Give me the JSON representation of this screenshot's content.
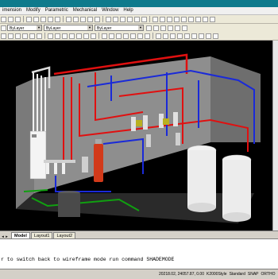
{
  "menu": [
    "imension",
    "Modify",
    "Parametric",
    "Mechanical",
    "Window",
    "Help"
  ],
  "properties": {
    "layer_combo": "ByLayer",
    "linetype_combo": "ByLayer",
    "lineweight_combo": "ByLayer"
  },
  "viewport": {
    "background": "#000000",
    "pipe_red": "#e01010",
    "pipe_blue": "#1a2ad8",
    "pipe_green": "#10a010",
    "wall_gray": "#8a8a8a"
  },
  "tabs": [
    "Model",
    "Layout1",
    "Layout2"
  ],
  "command": {
    "line1": "r to switch back to wireframe mode run command SHADEMODE"
  },
  "status": {
    "coords": "20218.02, 24057.87, 0.00",
    "style": "K2000Style",
    "standard": "Standard",
    "buttons": [
      "SNAP",
      "ORTHO"
    ]
  }
}
